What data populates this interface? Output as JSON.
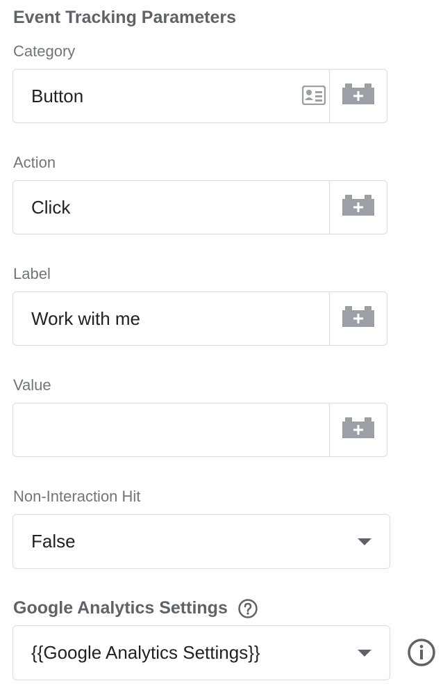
{
  "section": {
    "title": "Event Tracking Parameters"
  },
  "fields": {
    "category": {
      "label": "Category",
      "value": "Button"
    },
    "action": {
      "label": "Action",
      "value": "Click"
    },
    "label": {
      "label": "Label",
      "value": "Work with me"
    },
    "value": {
      "label": "Value",
      "value": ""
    }
  },
  "non_interaction": {
    "label": "Non-Interaction Hit",
    "selected": "False"
  },
  "ga_settings": {
    "label": "Google Analytics Settings",
    "selected": "{{Google Analytics Settings}}"
  },
  "icons": {
    "variable_picker": "lego-brick-plus-icon",
    "variable_card": "contact-card-icon",
    "help": "help-circle-icon",
    "info": "info-circle-icon",
    "dropdown": "caret-down-icon"
  },
  "colors": {
    "border": "#dadce0",
    "icon": "#9aa0a6",
    "label": "#70757a",
    "text": "#202124"
  }
}
